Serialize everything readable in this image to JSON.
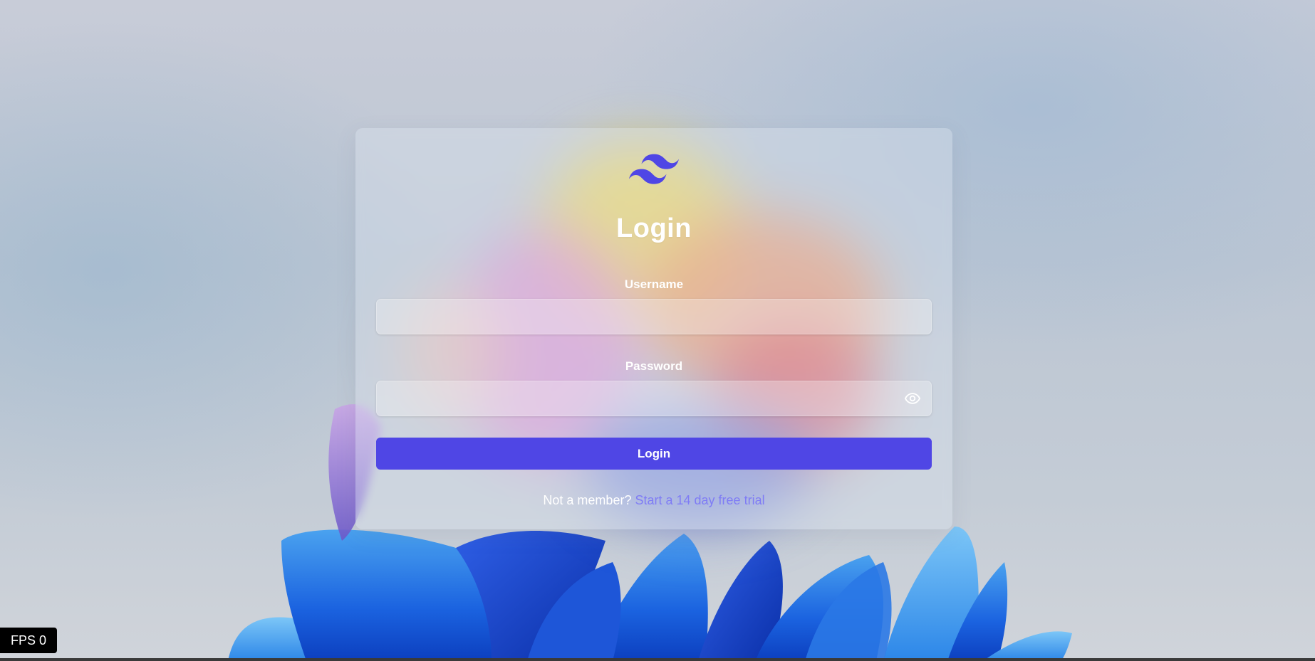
{
  "login_card": {
    "title": "Login",
    "username": {
      "label": "Username",
      "value": "",
      "placeholder": ""
    },
    "password": {
      "label": "Password",
      "value": "",
      "placeholder": "",
      "toggle_icon": "eye-icon"
    },
    "submit_label": "Login",
    "signup_prompt": "Not a member?",
    "signup_link": "Start a 14 day free trial"
  },
  "logo_icon": "tailwind-logo",
  "fps": {
    "label": "FPS 0"
  },
  "colors": {
    "accent": "#4f46e5",
    "link": "#7f7cf5",
    "logo": "#4f46e5",
    "text_on_card": "#ffffff"
  }
}
